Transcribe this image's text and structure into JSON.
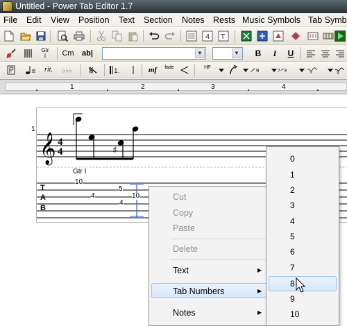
{
  "window": {
    "title": "Untitled - Power Tab Editor 1.7"
  },
  "menubar": {
    "items": [
      "File",
      "Edit",
      "View",
      "Position",
      "Text",
      "Section",
      "Notes",
      "Rests",
      "Music Symbols",
      "Tab Symb"
    ]
  },
  "toolbar2": {
    "gtr_label": "Gtr\nI",
    "chord_label": "Cm",
    "text_label": "ab|"
  },
  "toolbar3": {
    "rit_label": "rit.",
    "dynamic_label": "mf",
    "fade_label": "fade",
    "hp_label": "HP"
  },
  "ruler": {
    "numbers": [
      "1",
      "2",
      "3",
      "4"
    ]
  },
  "score": {
    "system_number": "1",
    "time_signature": [
      "4",
      "4"
    ],
    "guitar_label": "Gtr I",
    "tab_clef": [
      "T",
      "A",
      "B"
    ],
    "tab_numbers": [
      {
        "id": "n1",
        "text": "10"
      },
      {
        "id": "n2",
        "text": "4"
      },
      {
        "id": "n3",
        "text": "5"
      },
      {
        "id": "n4",
        "text": "4"
      },
      {
        "id": "n5",
        "text": "10"
      }
    ]
  },
  "context_menu": {
    "cut": "Cut",
    "copy": "Copy",
    "paste": "Paste",
    "delete": "Delete",
    "text": "Text",
    "tab_numbers": "Tab Numbers",
    "notes": "Notes"
  },
  "submenu": {
    "items": [
      "0",
      "1",
      "2",
      "3",
      "4",
      "5",
      "6",
      "7",
      "8",
      "9",
      "10"
    ],
    "highlighted": "8"
  },
  "colors": {
    "title_bar": "#3a4349",
    "menu_highlight": "#d6e8fa",
    "cursor_blue": "#3b5bdb"
  }
}
